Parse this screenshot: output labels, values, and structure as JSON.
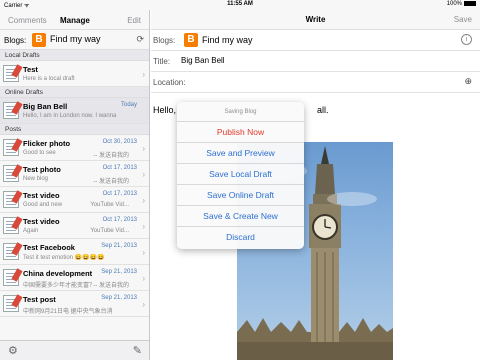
{
  "statusbar": {
    "carrier": "Carrier ᯤ",
    "time": "11:55 AM",
    "battery": "100%"
  },
  "sidebar": {
    "nav": {
      "comments": "Comments",
      "manage": "Manage",
      "edit": "Edit"
    },
    "blogs_label": "Blogs:",
    "blog_name": "Find my way",
    "sections": {
      "local_drafts": "Local Drafts",
      "online_drafts": "Online Drafts",
      "posts": "Posts"
    },
    "local_drafts": [
      {
        "title": "Test",
        "sub": "Here is a local draft",
        "date": "",
        "extra": ""
      }
    ],
    "online_drafts": [
      {
        "title": "Big Ban Bell",
        "sub": "Hello, I am in London now. I wanna",
        "date": "Today",
        "extra": ""
      }
    ],
    "posts": [
      {
        "title": "Flicker photo",
        "sub": "Good to see",
        "date": "Oct 30, 2013",
        "extra": "-- 发送自我的"
      },
      {
        "title": "Test photo",
        "sub": "New blog",
        "date": "Oct 17, 2013",
        "extra": "-- 发送自我的"
      },
      {
        "title": "Test video",
        "sub": "Good and new",
        "date": "Oct 17, 2013",
        "extra": "YouTube Vid..."
      },
      {
        "title": "Test video",
        "sub": "Again",
        "date": "Oct 17, 2013",
        "extra": "YouTube Vid..."
      },
      {
        "title": "Test Facebook",
        "sub": "Test it test emotion 😄😄😄😄",
        "date": "Sep 21, 2013",
        "extra": ""
      },
      {
        "title": "China development",
        "sub": "中国需要多少年才能变富？",
        "date": "Sep 21, 2013",
        "extra": "-- 发送自我的"
      },
      {
        "title": "Test post",
        "sub": "中新网9月21日电  据中央气象台消",
        "date": "Sep 21, 2013",
        "extra": ""
      }
    ]
  },
  "main": {
    "nav": {
      "title": "Write",
      "save": "Save"
    },
    "blogs_label": "Blogs:",
    "blog_name": "Find my way",
    "title_label": "Title:",
    "title_value": "Big Ban Bell",
    "location_label": "Location:",
    "body_start": "Hello,",
    "body_end": "all."
  },
  "popover": {
    "title": "Saving Blog",
    "options": [
      "Publish Now",
      "Save and Preview",
      "Save Local Draft",
      "Save Online Draft",
      "Save & Create New",
      "Discard"
    ]
  },
  "colors": {
    "accent": "#2d6fd1",
    "destructive": "#e0392b",
    "blogger": "#f57d00",
    "date": "#4a7ab5"
  }
}
